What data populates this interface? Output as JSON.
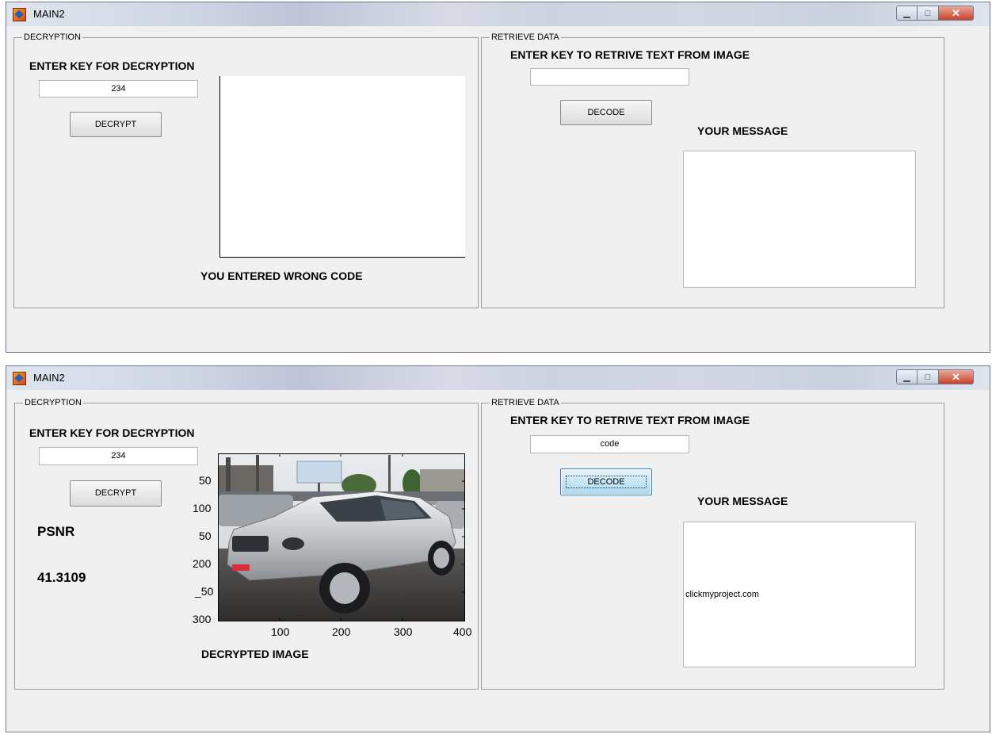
{
  "window1": {
    "title": "MAIN2",
    "decryption_panel": {
      "title": "DECRYPTION",
      "key_label": "ENTER KEY FOR DECRYPTION",
      "key_value": "234",
      "decrypt_button": "DECRYPT",
      "status": "YOU ENTERED WRONG CODE"
    },
    "retrieve_panel": {
      "title": "RETRIEVE DATA",
      "key_label": "ENTER KEY TO RETRIVE TEXT FROM IMAGE",
      "key_value": "",
      "decode_button": "DECODE",
      "message_label": "YOUR MESSAGE"
    }
  },
  "window2": {
    "title": "MAIN2",
    "decryption_panel": {
      "title": "DECRYPTION",
      "key_label": "ENTER KEY FOR DECRYPTION",
      "key_value": "234",
      "decrypt_button": "DECRYPT",
      "psnr_label": "PSNR",
      "psnr_value": "41.3109",
      "image_caption": "DECRYPTED IMAGE",
      "y_ticks": [
        "50",
        "100",
        "50",
        "200",
        "_50",
        "300"
      ],
      "x_ticks": [
        "100",
        "200",
        "300",
        "400"
      ]
    },
    "retrieve_panel": {
      "title": "RETRIEVE DATA",
      "key_label": "ENTER KEY TO RETRIVE TEXT FROM IMAGE",
      "key_value": "code",
      "decode_button": "DECODE",
      "message_label": "YOUR MESSAGE",
      "message_text": "clickmyproject.com"
    }
  },
  "colors": {
    "window_bg": "#f0f0f0",
    "active_button": "#a9d8f3",
    "close_button": "#c7432b"
  }
}
